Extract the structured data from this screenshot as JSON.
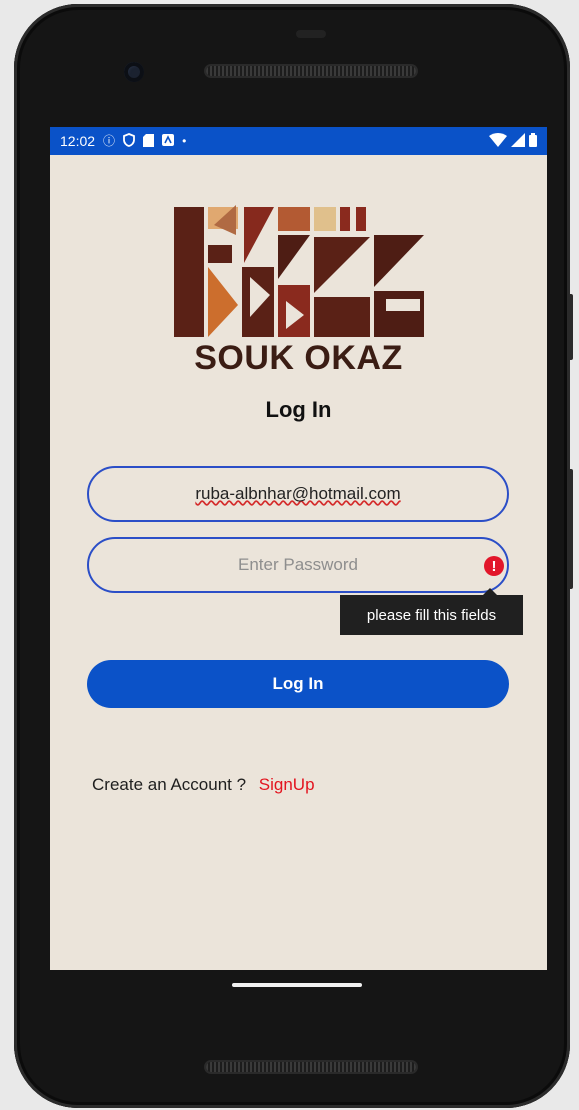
{
  "status_bar": {
    "time": "12:02"
  },
  "app": {
    "brand_name": "SOUK OKAZ",
    "title": "Log In",
    "email_value": "ruba-albnhar@hotmail.com",
    "password_placeholder": "Enter Password",
    "error_tooltip": "please fill this fields",
    "login_button": "Log In",
    "signup_prompt": "Create an Account ?",
    "signup_link": "SignUp"
  },
  "icons": {
    "status_left": [
      "info-icon",
      "shield-icon",
      "sd-card-icon",
      "a-icon",
      "dot-icon"
    ],
    "status_right": [
      "wifi-icon",
      "signal-icon",
      "battery-icon"
    ],
    "error": "error-alert-icon"
  },
  "colors": {
    "status_bar": "#0a52c8",
    "background": "#ebe4da",
    "field_border": "#2b4ec7",
    "button": "#0b52c8",
    "error": "#e2162a",
    "link": "#e3141f",
    "brand_text": "#3b1d14"
  }
}
